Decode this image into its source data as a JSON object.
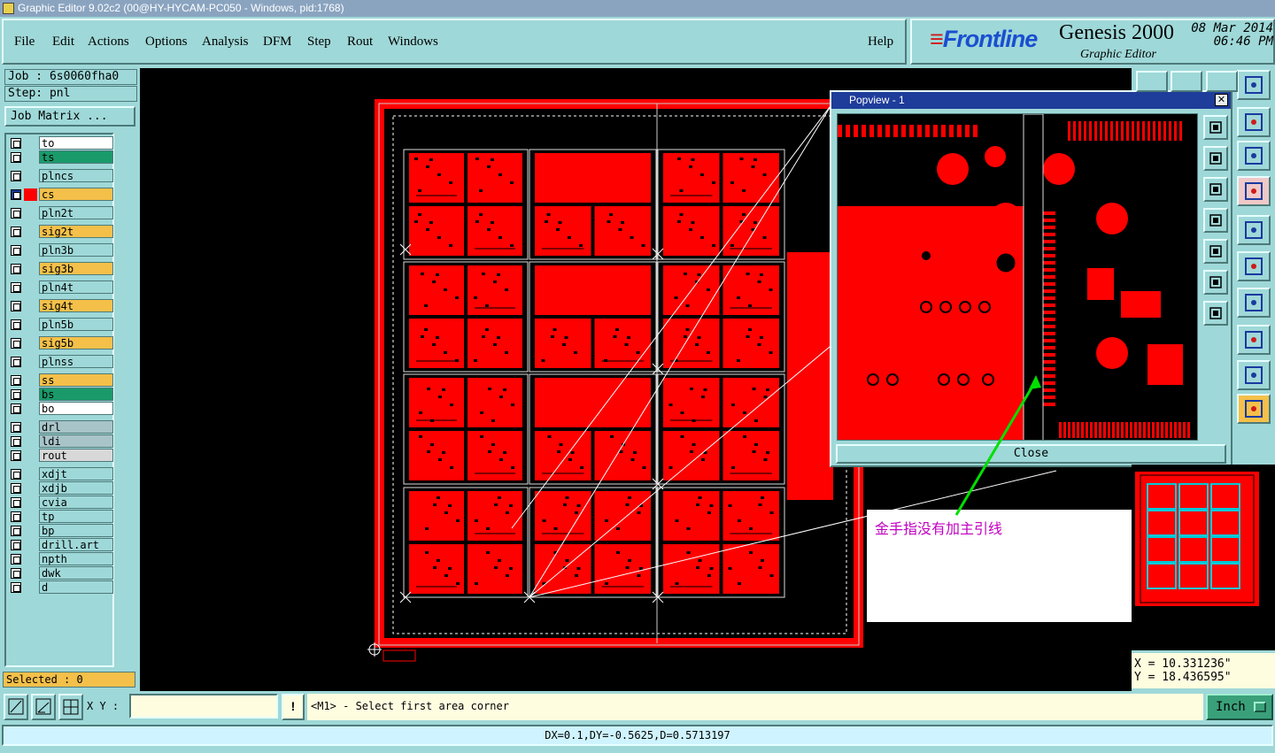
{
  "window": {
    "title": "Graphic Editor 9.02c2 (00@HY-HYCAM-PC050 - Windows, pid:1768)"
  },
  "menu": {
    "items": [
      "File",
      "Edit",
      "Actions",
      "Options",
      "Analysis",
      "DFM",
      "Step",
      "Rout",
      "Windows"
    ],
    "help": "Help"
  },
  "brand": {
    "logo": "Frontline",
    "product": "Genesis 2000",
    "subtitle": "Graphic Editor",
    "date": "08 Mar 2014",
    "time": "06:46 PM"
  },
  "job": {
    "job_label": "Job : 6s0060fha0",
    "step_label": "Step: pnl",
    "matrix_button": "Job Matrix ..."
  },
  "layers": [
    {
      "name": "to",
      "color": "#ffffff"
    },
    {
      "name": "ts",
      "color": "#1a9a6a"
    },
    {
      "name": "plncs",
      "color": "#9fd8d8"
    },
    {
      "name": "cs",
      "color": "#f4c04a",
      "active": true
    },
    {
      "name": "pln2t",
      "color": "#9fd8d8"
    },
    {
      "name": "sig2t",
      "color": "#f4c04a"
    },
    {
      "name": "pln3b",
      "color": "#9fd8d8"
    },
    {
      "name": "sig3b",
      "color": "#f4c04a"
    },
    {
      "name": "pln4t",
      "color": "#9fd8d8"
    },
    {
      "name": "sig4t",
      "color": "#f4c04a"
    },
    {
      "name": "pln5b",
      "color": "#9fd8d8"
    },
    {
      "name": "sig5b",
      "color": "#f4c04a"
    },
    {
      "name": "plnss",
      "color": "#9fd8d8"
    },
    {
      "name": "ss",
      "color": "#f4c04a"
    },
    {
      "name": "bs",
      "color": "#1a9a6a"
    },
    {
      "name": "bo",
      "color": "#ffffff"
    },
    {
      "name": "drl",
      "color": "#a8c4c8"
    },
    {
      "name": "ldi",
      "color": "#a8c4c8"
    },
    {
      "name": "rout",
      "color": "#d8d8d8"
    },
    {
      "name": "xdjt",
      "color": "#9fd8d8"
    },
    {
      "name": "xdjb",
      "color": "#9fd8d8"
    },
    {
      "name": "cvia",
      "color": "#9fd8d8"
    },
    {
      "name": "tp",
      "color": "#9fd8d8"
    },
    {
      "name": "bp",
      "color": "#9fd8d8"
    },
    {
      "name": "drill.art",
      "color": "#9fd8d8"
    },
    {
      "name": "npth",
      "color": "#9fd8d8"
    },
    {
      "name": "dwk",
      "color": "#9fd8d8"
    },
    {
      "name": "d",
      "color": "#9fd8d8"
    }
  ],
  "selected": "Selected : 0",
  "popview": {
    "title": "Popview - 1",
    "close_x": "✕",
    "close_button": "Close"
  },
  "annotation": "金手指没有加主引线",
  "coords": {
    "x": "X =  10.331236\"",
    "y": "Y =  18.436595\""
  },
  "bottom": {
    "xy_label": "X Y :",
    "xy_value": "",
    "warn": "!",
    "prompt": "<M1> - Select first area corner",
    "units": "Inch"
  },
  "status": "DX=0.1,DY=-0.5625,D=0.5713197",
  "colors": {
    "copper": "#ff0000",
    "background": "#000000",
    "panel": "#9fd8d8",
    "highlight": "#f4c04a",
    "annotation_text": "#c000c0",
    "annotation_arrow": "#00e000"
  }
}
